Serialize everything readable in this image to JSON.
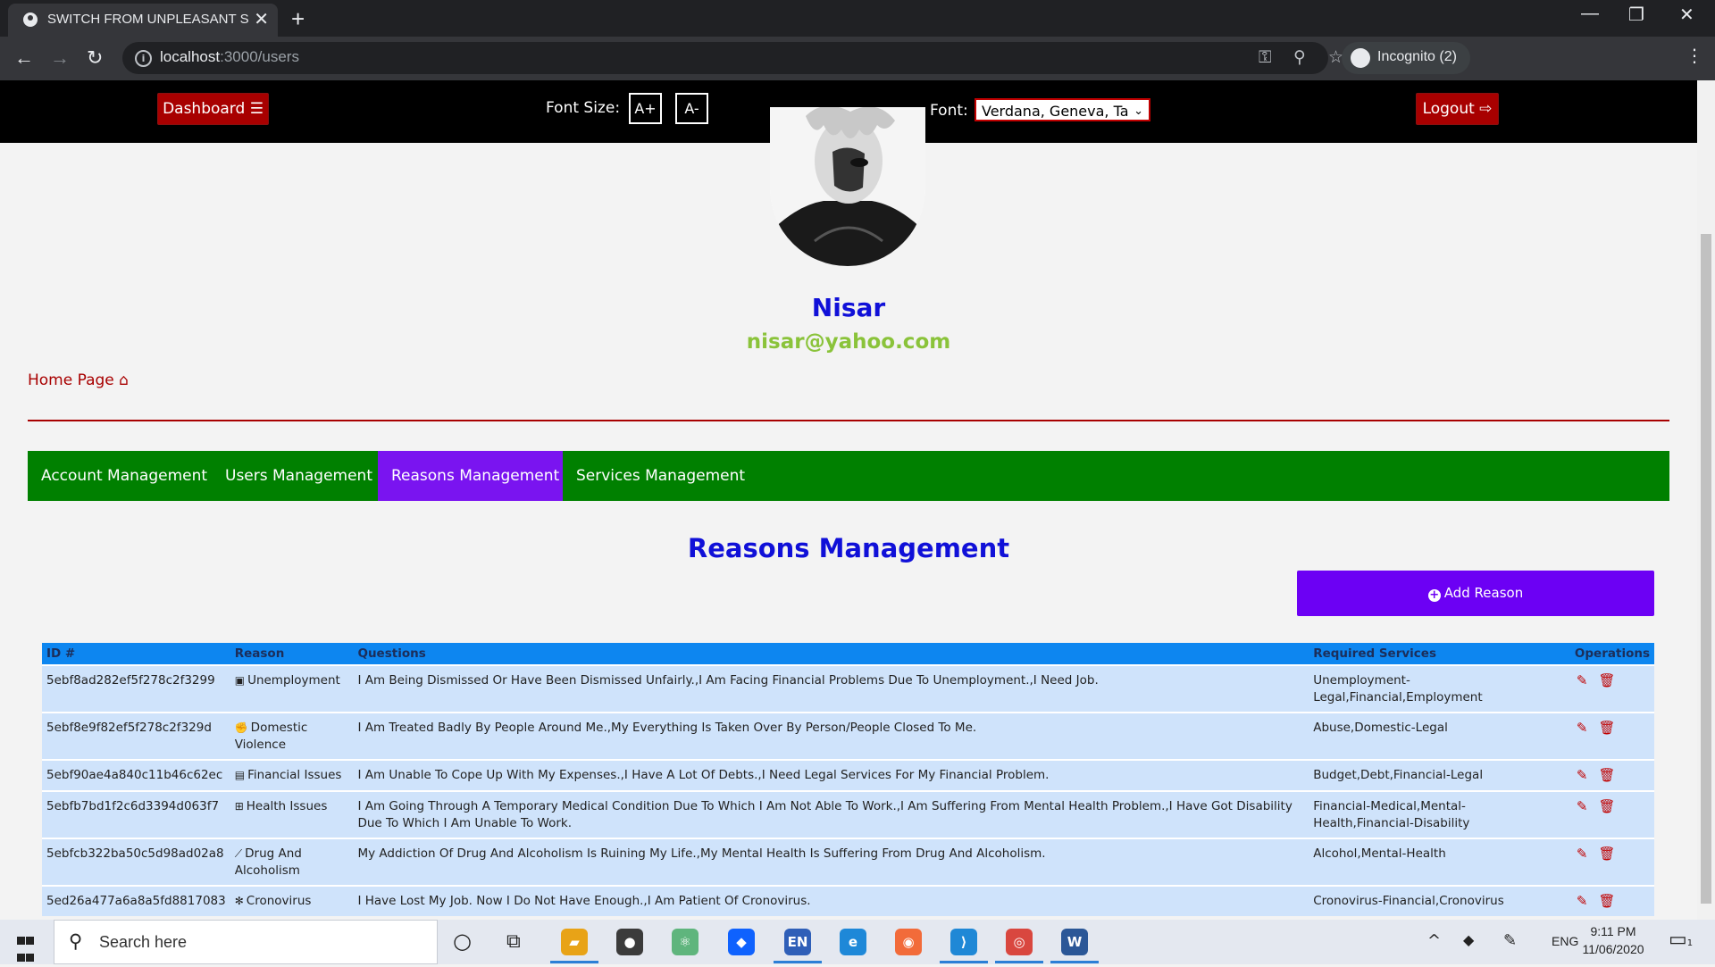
{
  "browser": {
    "tab_title": "SWITCH FROM UNPLEASANT SC",
    "url_host": "localhost",
    "url_path": ":3000/users",
    "incognito_label": "Incognito (2)",
    "new_tab_glyph": "+",
    "tab_close_glyph": "✕",
    "minimize_glyph": "—",
    "restore_glyph": "❐",
    "close_glyph": "✕",
    "back_glyph": "←",
    "forward_glyph": "→",
    "reload_glyph": "↻",
    "info_glyph": "i",
    "key_glyph": "⚿",
    "zoom_glyph": "⚲",
    "star_glyph": "☆",
    "kebab_glyph": "⋮"
  },
  "header": {
    "dashboard_label": "Dashboard ☰",
    "font_size_label": "Font Size:",
    "font_increase_label": "A+",
    "font_decrease_label": "A-",
    "font_label": "Font:",
    "font_select_value": "Verdana, Geneva, Ta",
    "font_select_chevron": "⌄",
    "logout_label": "Logout ⇨"
  },
  "profile": {
    "name": "Nisar",
    "email": "nisar@yahoo.com"
  },
  "home_link": "Home Page ⌂",
  "tabs": [
    {
      "label": "Account Management"
    },
    {
      "label": "Users Management"
    },
    {
      "label": "Reasons Management"
    },
    {
      "label": "Services Management"
    }
  ],
  "active_tab": "Reasons Management",
  "section_title": "Reasons Management",
  "add_reason_label": "Add Reason",
  "add_reason_icon": "+",
  "table": {
    "headers": [
      "ID #",
      "Reason",
      "Questions",
      "Required Services",
      "Operations"
    ],
    "edit_glyph": "✎",
    "delete_glyph": "🗑",
    "rows": [
      {
        "id": "5ebf8ad282ef5f278c2f3299",
        "icon": "▣",
        "reason": "Unemployment",
        "questions": "I Am Being Dismissed Or Have Been Dismissed Unfairly.,I Am Facing Financial Problems Due To Unemployment.,I Need Job.",
        "services": "Unemployment-Legal,Financial,Employment"
      },
      {
        "id": "5ebf8e9f82ef5f278c2f329d",
        "icon": "✊",
        "reason": "Domestic Violence",
        "questions": "I Am Treated Badly By People Around Me.,My Everything Is Taken Over By Person/People Closed To Me.",
        "services": "Abuse,Domestic-Legal"
      },
      {
        "id": "5ebf90ae4a840c11b46c62ec",
        "icon": "▤",
        "reason": "Financial Issues",
        "questions": "I Am Unable To Cope Up With My Expenses.,I Have A Lot Of Debts.,I Need Legal Services For My Financial Problem.",
        "services": "Budget,Debt,Financial-Legal"
      },
      {
        "id": "5ebfb7bd1f2c6d3394d063f7",
        "icon": "⊞",
        "reason": "Health Issues",
        "questions": "I Am Going Through A Temporary Medical Condition Due To Which I Am Not Able To Work.,I Am Suffering From Mental Health Problem.,I Have Got Disability Due To Which I Am Unable To Work.",
        "services": "Financial-Medical,Mental-Health,Financial-Disability"
      },
      {
        "id": "5ebfcb322ba50c5d98ad02a8",
        "icon": "⟋",
        "reason": "Drug And Alcoholism",
        "questions": "My Addiction Of Drug And Alcoholism Is Ruining My Life.,My Mental Health Is Suffering From Drug And Alcoholism.",
        "services": "Alcohol,Mental-Health"
      },
      {
        "id": "5ed26a477a6a8a5fd8817083",
        "icon": "✻",
        "reason": "Cronovirus",
        "questions": "I Have Lost My Job. Now I Do Not Have Enough.,I Am Patient Of Cronovirus.",
        "services": "Cronovirus-Financial,Cronovirus"
      }
    ]
  },
  "taskbar": {
    "search_placeholder": "Search here",
    "search_glyph": "⚲",
    "cortana_glyph": "○",
    "taskview_glyph": "⧉",
    "apps": [
      {
        "name": "file-explorer",
        "glyph": "▰",
        "color": "#e8a317"
      },
      {
        "name": "github",
        "glyph": "●",
        "color": "#3b3b3b"
      },
      {
        "name": "atom",
        "glyph": "⚛",
        "color": "#5fb57d"
      },
      {
        "name": "dropbox",
        "glyph": "◆",
        "color": "#0f62fe"
      },
      {
        "name": "en-keyboard",
        "glyph": "EN",
        "color": "#2f5fb8"
      },
      {
        "name": "edge",
        "glyph": "e",
        "color": "#1e88d8"
      },
      {
        "name": "postman",
        "glyph": "◉",
        "color": "#f26b3a"
      },
      {
        "name": "vscode",
        "glyph": "⟩",
        "color": "#1f88d6"
      },
      {
        "name": "chrome",
        "glyph": "◎",
        "color": "#d9473f"
      },
      {
        "name": "word",
        "glyph": "W",
        "color": "#2b5797"
      }
    ],
    "tray_chevron": "^",
    "tray_dropbox": "◆",
    "tray_pen": "✎",
    "language": "ENG",
    "time": "9:11 PM",
    "date": "11/06/2020",
    "notification_count": "1",
    "notification_glyph": "▭"
  },
  "colors": {
    "header_bg": "#000000",
    "accent_red": "#a80000",
    "nav_green": "#008000",
    "active_purple": "#7a14f0",
    "title_blue": "#1010d8",
    "email_green": "#8ac33a",
    "table_header": "#0d86f0",
    "table_row": "#cfe3fb"
  }
}
